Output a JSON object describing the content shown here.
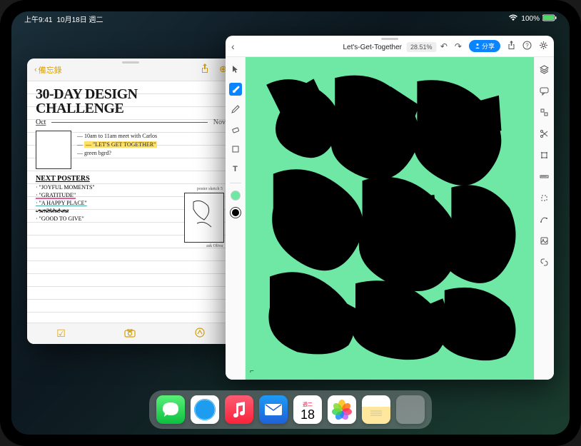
{
  "status": {
    "time": "上午9:41",
    "date": "10月18日 週二",
    "battery": "100%"
  },
  "notes": {
    "back_label": "備忘錄",
    "title": "30-DAY DESIGN CHALLENGE",
    "date_start": "Oct",
    "date_end": "Nov",
    "bullets": {
      "b1": "— 10am to 11am meet with Carlos",
      "b2": "— \"LET'S GET TOGETHER\"",
      "b3": "— green bgrd?"
    },
    "section_next": "NEXT POSTERS",
    "posters": {
      "p1": "· \"JOYFUL MOMENTS\"",
      "p2": "· \"GRATITUDE\"",
      "p3": "· \"A HAPPY PLACE\"",
      "p4": "· scribbled out",
      "p5": "· \"GOOD TO GIVE\""
    },
    "sketch_label": "poster sketch 5",
    "author": "ask Oliva"
  },
  "draw": {
    "title": "Let's-Get-Together",
    "zoom": "28.51%",
    "share_label": "分享"
  },
  "dock": {
    "calendar_weekday": "週二",
    "calendar_day": "18"
  }
}
